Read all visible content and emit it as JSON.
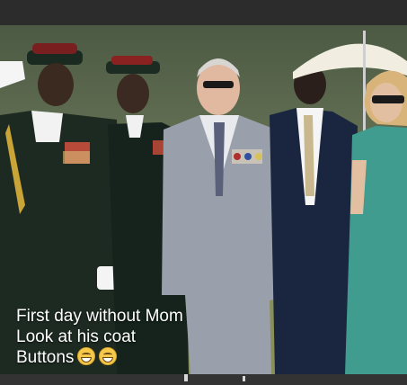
{
  "post": {
    "caption_lines": [
      "First day without Mom",
      "Look at his coat",
      "Buttons"
    ],
    "emoji_icons": [
      "grinning-sweat-icon",
      "grinning-sweat-icon"
    ]
  }
}
